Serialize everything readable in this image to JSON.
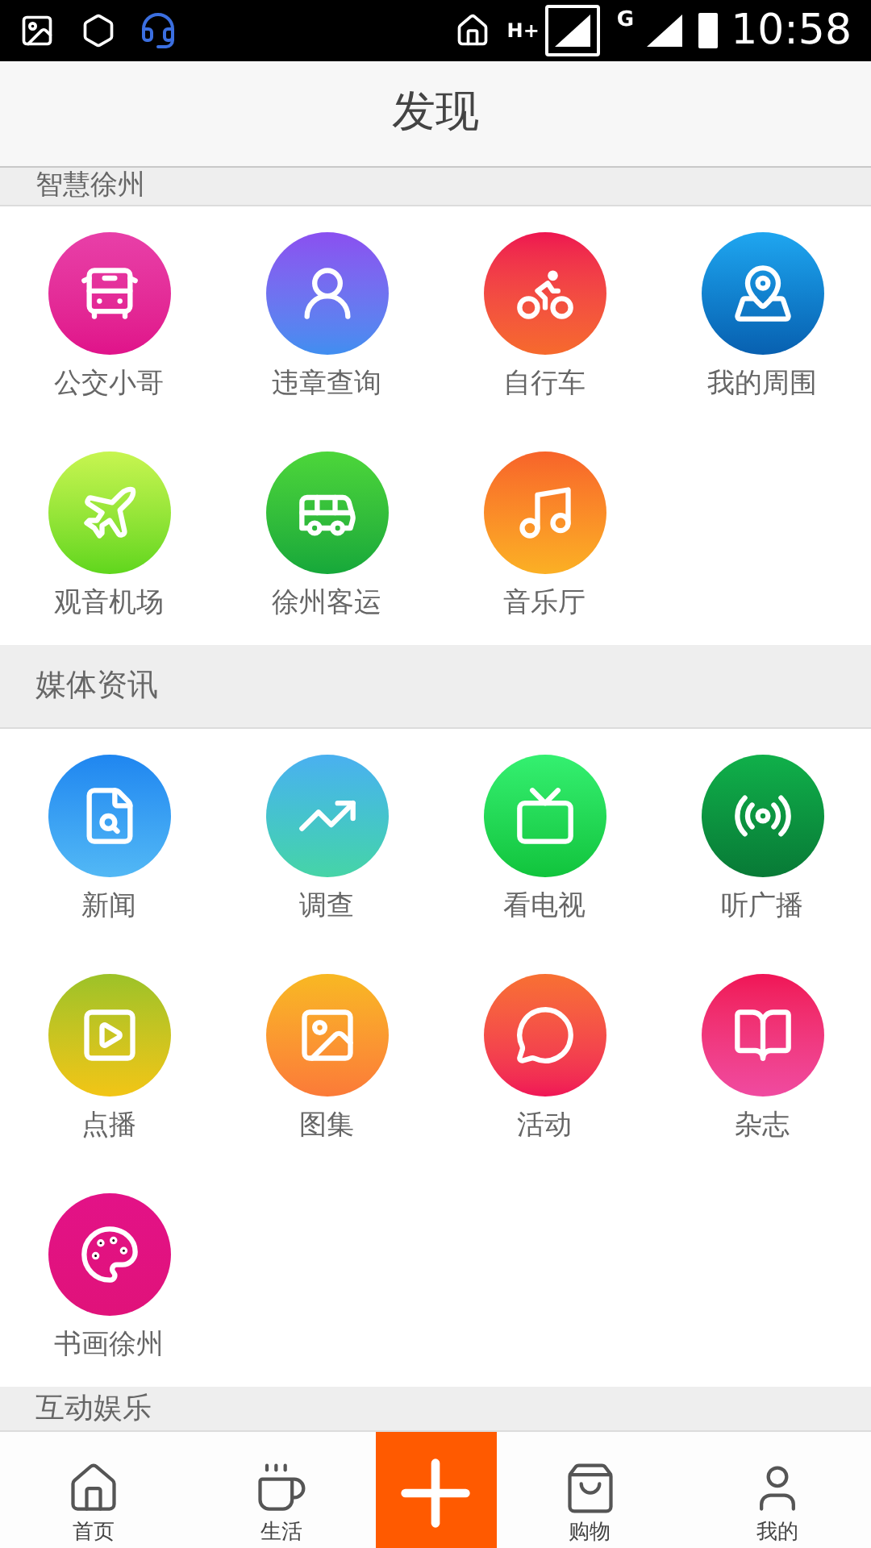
{
  "status_bar": {
    "network_labels": [
      "H+",
      "G"
    ],
    "time": "10:58"
  },
  "header": {
    "title": "发现"
  },
  "sections": [
    {
      "title": "智慧徐州",
      "items": [
        {
          "label": "公交小哥"
        },
        {
          "label": "违章查询"
        },
        {
          "label": "自行车"
        },
        {
          "label": "我的周围"
        },
        {
          "label": "观音机场"
        },
        {
          "label": "徐州客运"
        },
        {
          "label": "音乐厅"
        }
      ]
    },
    {
      "title": "媒体资讯",
      "items": [
        {
          "label": "新闻"
        },
        {
          "label": "调查"
        },
        {
          "label": "看电视"
        },
        {
          "label": "听广播"
        },
        {
          "label": "点播"
        },
        {
          "label": "图集"
        },
        {
          "label": "活动"
        },
        {
          "label": "杂志"
        },
        {
          "label": "书画徐州"
        }
      ]
    },
    {
      "title": "互动娱乐"
    }
  ],
  "tab_bar": [
    {
      "kind": "tab",
      "label": "首页"
    },
    {
      "kind": "tab",
      "label": "生活"
    },
    {
      "kind": "add"
    },
    {
      "kind": "tab",
      "label": "购物"
    },
    {
      "kind": "tab",
      "label": "我的"
    }
  ]
}
